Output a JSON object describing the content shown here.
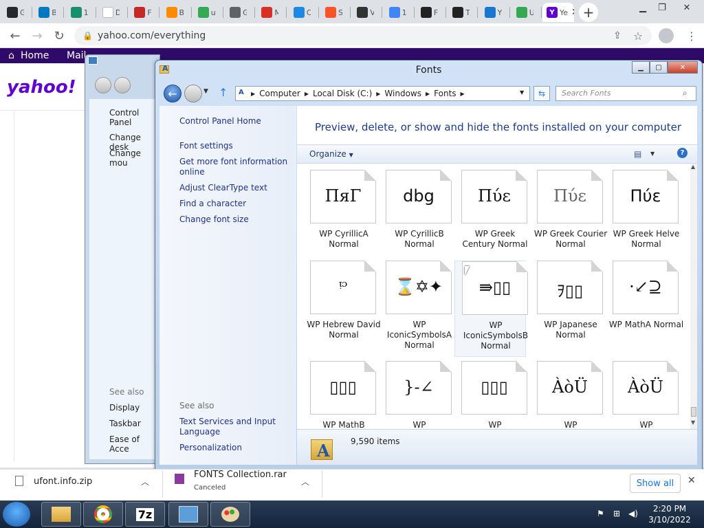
{
  "browser": {
    "tabs": [
      {
        "letter": "G",
        "icon": "github-icon",
        "color": "#24292e"
      },
      {
        "letter": "B",
        "icon": "trello-icon",
        "color": "#0079bf"
      },
      {
        "letter": "1",
        "icon": "m-icon",
        "color": "#1a8f6c"
      },
      {
        "letter": "D",
        "icon": "blank-page-icon",
        "color": "#ffffff"
      },
      {
        "letter": "F",
        "icon": "f-icon",
        "color": "#c62828"
      },
      {
        "letter": "B",
        "icon": "b-icon",
        "color": "#ff8a00"
      },
      {
        "letter": "u",
        "icon": "drive-icon",
        "color": "#34a853"
      },
      {
        "letter": "G",
        "icon": "globe-icon",
        "color": "#5f6368"
      },
      {
        "letter": "M",
        "icon": "m-icon-red",
        "color": "#d93025"
      },
      {
        "letter": "C",
        "icon": "appstore-icon",
        "color": "#1e88e5"
      },
      {
        "letter": "S",
        "icon": "brave-icon",
        "color": "#fb542b"
      },
      {
        "letter": "V",
        "icon": "museum-icon",
        "color": "#333333"
      },
      {
        "letter": "1",
        "icon": "google-icon",
        "color": "#4285f4"
      },
      {
        "letter": "F",
        "icon": "pp-icon",
        "color": "#222222"
      },
      {
        "letter": "T",
        "icon": "pp-icon",
        "color": "#222222"
      },
      {
        "letter": "Y",
        "icon": "lb-icon",
        "color": "#1976d2"
      },
      {
        "letter": "U",
        "icon": "drive-icon",
        "color": "#34a853"
      }
    ],
    "active_tab": {
      "letter": "Ye"
    },
    "url": "yahoo.com/everything"
  },
  "yahoo": {
    "nav_home": "Home",
    "nav_mail": "Mail",
    "logo": "yahoo!"
  },
  "behind_window": {
    "links": [
      "Control Panel",
      "Change desk",
      "Change mou"
    ],
    "see_also": "See also",
    "see_also_links": [
      "Display",
      "Taskbar",
      "Ease of Acce"
    ]
  },
  "fonts_window": {
    "title": "Fonts",
    "breadcrumb": [
      "Computer",
      "Local Disk (C:)",
      "Windows",
      "Fonts"
    ],
    "search_placeholder": "Search Fonts",
    "left_links": [
      "Control Panel Home",
      "Font settings",
      "Get more font information online",
      "Adjust ClearType text",
      "Find a character",
      "Change font size"
    ],
    "see_also": "See also",
    "see_also_links": [
      "Text Services and Input Language",
      "Personalization"
    ],
    "header": "Preview, delete, or show and hide the fonts installed on your computer",
    "organize": "Organize",
    "item_count": "9,590 items",
    "fonts": [
      {
        "name": "WP CyrillicA Normal",
        "glyph": "ПяΓ"
      },
      {
        "name": "WP CyrillicB Normal",
        "glyph": "dbg"
      },
      {
        "name": "WP Greek Century Normal",
        "glyph": "Πύε"
      },
      {
        "name": "WP Greek Courier Normal",
        "glyph": "Πύε"
      },
      {
        "name": "WP Greek Helve Normal",
        "glyph": "Πύε"
      },
      {
        "name": "WP Hebrew David Normal",
        "glyph": "ᵎᵓ"
      },
      {
        "name": "WP IconicSymbolsA Normal",
        "glyph": "⌛✡✦"
      },
      {
        "name": "WP IconicSymbolsB Normal",
        "glyph": "⇛▯▯"
      },
      {
        "name": "WP Japanese Normal",
        "glyph": "ｦ▯▯"
      },
      {
        "name": "WP MathA Normal",
        "glyph": "·↙⊇"
      },
      {
        "name": "WP MathB",
        "glyph": "▯▯▯"
      },
      {
        "name": "WP",
        "glyph": "}-∠"
      },
      {
        "name": "WP",
        "glyph": "▯▯▯"
      },
      {
        "name": "WP",
        "glyph": "ÀòÜ"
      },
      {
        "name": "WP",
        "glyph": "ÀòÜ"
      }
    ]
  },
  "downloads": {
    "item1": "ufont.info.zip",
    "item2": "FONTS Collection.rar",
    "item2_status": "Canceled",
    "show_all": "Show all"
  },
  "taskbar": {
    "time": "2:20 PM",
    "date": "3/10/2022",
    "app_7z": "7z"
  }
}
